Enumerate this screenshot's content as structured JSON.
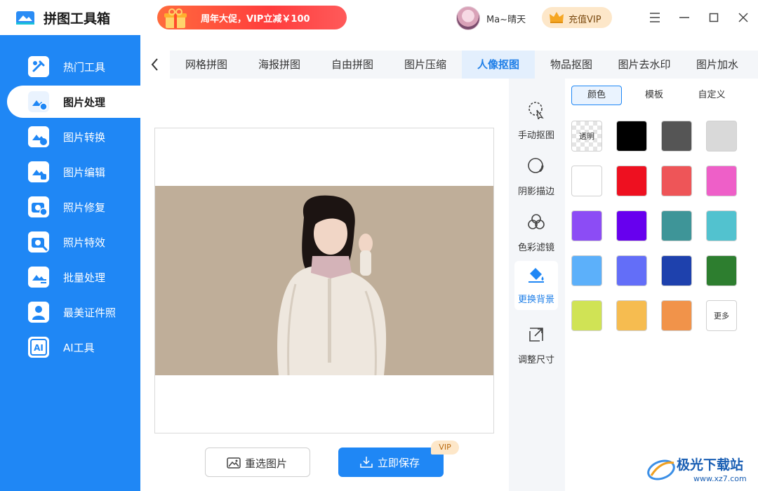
{
  "app": {
    "title": "拼图工具箱"
  },
  "promo": {
    "text": "周年大促，VIP立减￥100"
  },
  "user": {
    "name": "Ma~晴天"
  },
  "vip_button": {
    "label": "充值VIP"
  },
  "sidebar": {
    "items": [
      {
        "label": "热门工具",
        "icon": "hot-tools-icon",
        "active": false
      },
      {
        "label": "图片处理",
        "icon": "image-process-icon",
        "active": true
      },
      {
        "label": "图片转换",
        "icon": "image-convert-icon",
        "active": false
      },
      {
        "label": "图片编辑",
        "icon": "image-edit-icon",
        "active": false
      },
      {
        "label": "照片修复",
        "icon": "photo-repair-icon",
        "active": false
      },
      {
        "label": "照片特效",
        "icon": "photo-effect-icon",
        "active": false
      },
      {
        "label": "批量处理",
        "icon": "batch-process-icon",
        "active": false
      },
      {
        "label": "最美证件照",
        "icon": "id-photo-icon",
        "active": false
      },
      {
        "label": "AI工具",
        "icon": "ai-tools-icon",
        "active": false
      }
    ]
  },
  "tabs": [
    {
      "label": "网格拼图"
    },
    {
      "label": "海报拼图"
    },
    {
      "label": "自由拼图"
    },
    {
      "label": "图片压缩"
    },
    {
      "label": "人像抠图",
      "active": true
    },
    {
      "label": "物品抠图"
    },
    {
      "label": "图片去水印"
    },
    {
      "label": "图片加水"
    }
  ],
  "tools": [
    {
      "label": "手动抠图",
      "icon": "manual-cutout-icon"
    },
    {
      "label": "阴影描边",
      "icon": "shadow-stroke-icon"
    },
    {
      "label": "色彩滤镜",
      "icon": "color-filter-icon"
    },
    {
      "label": "更换背景",
      "icon": "paint-bucket-icon",
      "active": true
    },
    {
      "label": "调整尺寸",
      "icon": "resize-icon"
    }
  ],
  "panel": {
    "subtabs": [
      {
        "label": "颜色",
        "active": true
      },
      {
        "label": "模板"
      },
      {
        "label": "自定义"
      }
    ],
    "transparent_label": "透明",
    "more_label": "更多",
    "colors": [
      "#000000",
      "#555555",
      "#d9d9d9",
      "#ffffff",
      "#ee1020",
      "#ee5558",
      "#ee5fc8",
      "#8c4cf5",
      "#6700ee",
      "#3e9598",
      "#52c2cf",
      "#5cb0fa",
      "#636ef8",
      "#1e41ad",
      "#2d7e2f",
      "#d0e355",
      "#f6bc50",
      "#f1934a"
    ]
  },
  "buttons": {
    "reselect": "重选图片",
    "save": "立即保存",
    "vip_tag": "VIP"
  },
  "watermark": {
    "text": "极光下载站",
    "url": "www.xz7.com"
  }
}
